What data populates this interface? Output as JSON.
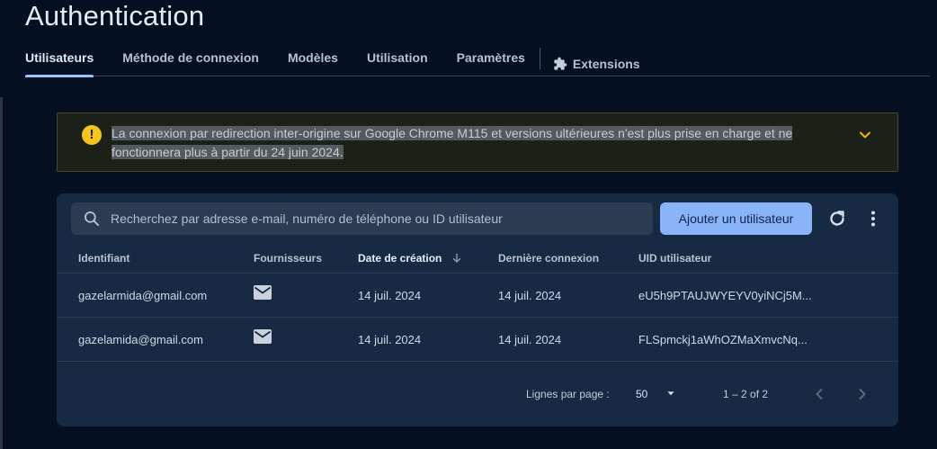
{
  "page": {
    "title": "Authentication"
  },
  "tabs": [
    {
      "label": "Utilisateurs",
      "active": true
    },
    {
      "label": "Méthode de connexion"
    },
    {
      "label": "Modèles"
    },
    {
      "label": "Utilisation"
    },
    {
      "label": "Paramètres"
    },
    {
      "label": "Extensions",
      "icon": "puzzle-icon"
    }
  ],
  "banner": {
    "icon": "warning-icon",
    "line1": "La connexion par redirection inter-origine sur Google Chrome M115 et versions ultérieures n'est plus prise en charge et ne",
    "line2": "fonctionnera plus à partir du 24 juin 2024.",
    "expand_icon": "chevron-down-icon"
  },
  "toolbar": {
    "search_placeholder": "Recherchez par adresse e-mail, numéro de téléphone ou ID utilisateur",
    "add_user_label": "Ajouter un utilisateur",
    "refresh_icon": "refresh-icon",
    "more_icon": "more-vert-icon"
  },
  "table": {
    "columns": [
      "Identifiant",
      "Fournisseurs",
      "Date de création",
      "Dernière connexion",
      "UID utilisateur"
    ],
    "sorted_column": "Date de création",
    "rows": [
      {
        "identifier": "gazelarmida@gmail.com",
        "provider": "mail-icon",
        "created": "14 juil. 2024",
        "last_login": "14 juil. 2024",
        "uid": "eU5h9PTAUJWYEYV0yiNCj5M..."
      },
      {
        "identifier": "gazelamida@gmail.com",
        "provider": "mail-icon",
        "created": "14 juil. 2024",
        "last_login": "14 juil. 2024",
        "uid": "FLSpmckj1aWhOZMaXmvcNq..."
      }
    ]
  },
  "pagination": {
    "rows_per_page_label": "Lignes par page :",
    "rows_per_page": "50",
    "range": "1 – 2 of 2"
  },
  "colors": {
    "background": "#041021",
    "card": "#172a43",
    "accent": "#8ab4f8",
    "warning": "#f5c518"
  }
}
